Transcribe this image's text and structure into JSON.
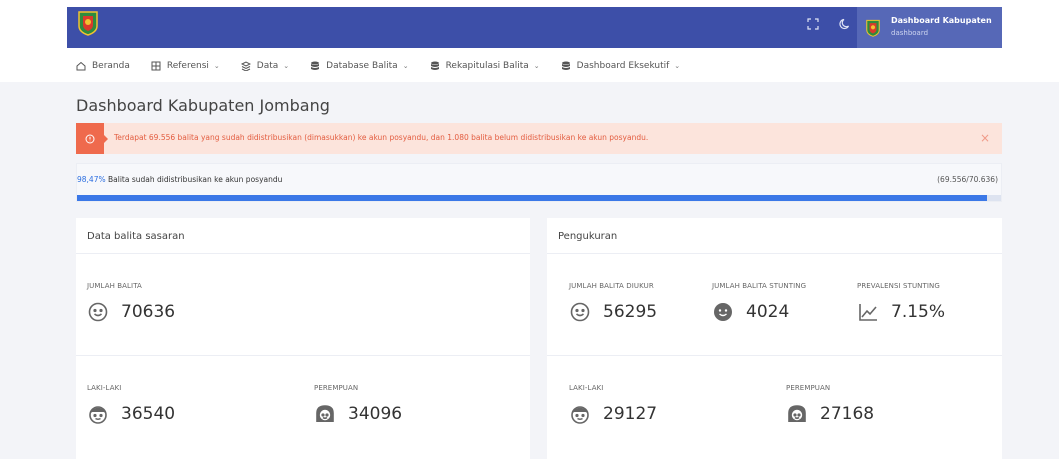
{
  "header": {
    "user_title": "Dashboard Kabupaten",
    "user_subtitle": "dashboard"
  },
  "nav": [
    {
      "label": "Beranda",
      "icon": "home-icon",
      "dropdown": false
    },
    {
      "label": "Referensi",
      "icon": "layers-icon",
      "dropdown": true
    },
    {
      "label": "Data",
      "icon": "stack-icon",
      "dropdown": true
    },
    {
      "label": "Database Balita",
      "icon": "database-icon",
      "dropdown": true
    },
    {
      "label": "Rekapitulasi Balita",
      "icon": "database-icon",
      "dropdown": true
    },
    {
      "label": "Dashboard Eksekutif",
      "icon": "database-icon",
      "dropdown": true
    }
  ],
  "page": {
    "title": "Dashboard Kabupaten Jombang"
  },
  "alert": {
    "text": "Terdapat 69.556 balita yang sudah didistribusikan (dimasukkan) ke akun posyandu, dan 1.080 balita belum didistribusikan ke akun posyandu.",
    "close": "×"
  },
  "progress": {
    "percent_text": "98,47%",
    "text": " Balita sudah didistribusikan ke akun posyandu",
    "count": "(69.556/70.636)",
    "value": 0.9847
  },
  "data_balita": {
    "title": "Data balita sasaran",
    "jumlah_label": "JUMLAH BALITA",
    "jumlah_value": "70636",
    "laki_label": "LAKI-LAKI",
    "laki_value": "36540",
    "perempuan_label": "PEREMPUAN",
    "perempuan_value": "34096"
  },
  "pengukuran": {
    "title": "Pengukuran",
    "diukur_label": "JUMLAH BALITA DIUKUR",
    "diukur_value": "56295",
    "stunting_label": "JUMLAH BALITA STUNTING",
    "stunting_value": "4024",
    "prevalensi_label": "PREVALENSI STUNTING",
    "prevalensi_value": "7.15%",
    "laki_label": "LAKI-LAKI",
    "laki_value": "29127",
    "perempuan_label": "PEREMPUAN",
    "perempuan_value": "27168"
  },
  "colors": {
    "header": "#3d4fa8",
    "alert": "#ef6a4d",
    "progress": "#3b78e7"
  }
}
